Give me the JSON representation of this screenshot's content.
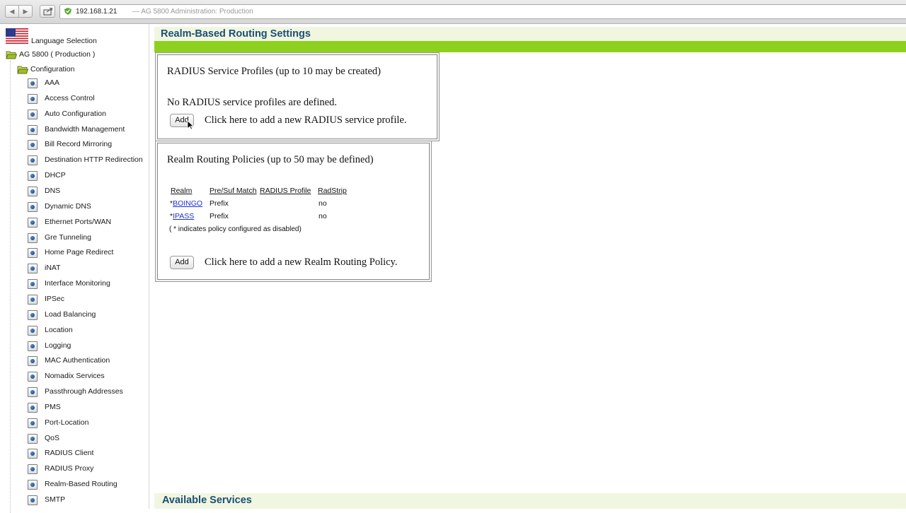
{
  "browser": {
    "url": "192.168.1.21",
    "page_title": "— AG 5800  Administration:  Production"
  },
  "sidebar": {
    "language_selection": "Language Selection",
    "root": "AG 5800 ( Production )",
    "configuration": "Configuration",
    "items": [
      "AAA",
      "Access Control",
      "Auto Configuration",
      "Bandwidth Management",
      "Bill Record Mirroring",
      "Destination HTTP Redirection",
      "DHCP",
      "DNS",
      "Dynamic DNS",
      "Ethernet Ports/WAN",
      "Gre Tunneling",
      "Home Page Redirect",
      "iNAT",
      "Interface Monitoring",
      "IPSec",
      "Load Balancing",
      "Location",
      "Logging",
      "MAC Authentication",
      "Nomadix Services",
      "Passthrough Addresses",
      "PMS",
      "Port-Location",
      "QoS",
      "RADIUS Client",
      "RADIUS Proxy",
      "Realm-Based Routing",
      "SMTP"
    ]
  },
  "main": {
    "title": "Realm-Based Routing Settings",
    "radius_panel": {
      "title": "RADIUS Service Profiles (up to 10 may be created)",
      "empty_text": "No RADIUS service profiles are defined.",
      "add_label": "Add",
      "add_text": "Click here to add a new RADIUS service profile."
    },
    "realm_panel": {
      "title": "Realm Routing Policies (up to 50 may be defined)",
      "headers": [
        "Realm",
        "Pre/Suf Match",
        "RADIUS Profile",
        "RadStrip"
      ],
      "rows": [
        {
          "prefix": "*",
          "realm": "BOINGO",
          "match": "Prefix",
          "profile": "",
          "radstrip": "no"
        },
        {
          "prefix": "*",
          "realm": "IPASS",
          "match": "Prefix",
          "profile": "",
          "radstrip": "no"
        }
      ],
      "note": "( * indicates policy configured as disabled)",
      "add_label": "Add",
      "add_text": "Click here to add a new Realm Routing Policy."
    },
    "services_title": "Available Services"
  }
}
